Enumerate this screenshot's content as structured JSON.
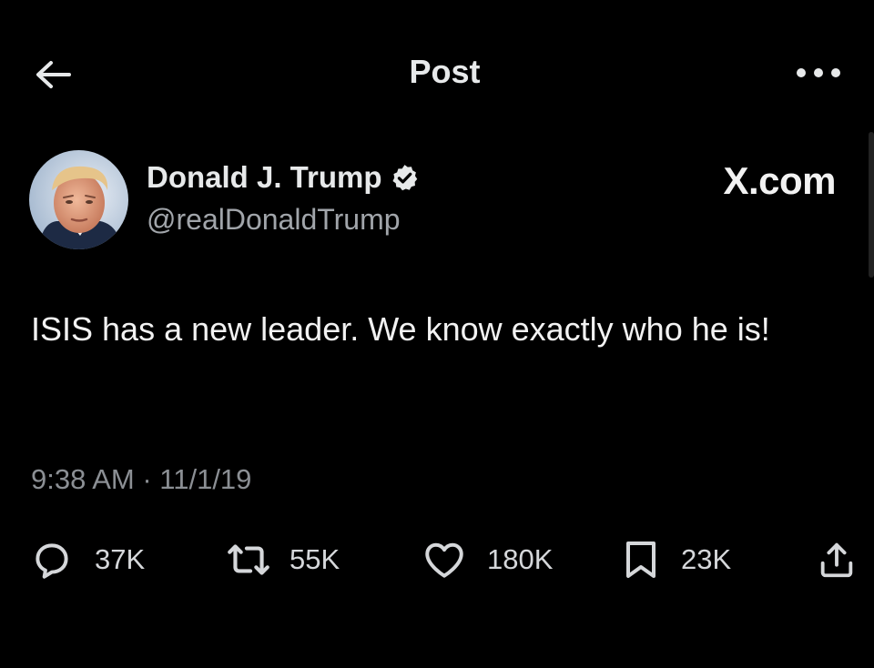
{
  "header": {
    "title": "Post",
    "back_icon": "arrow-left-icon",
    "more_icon": "more-horizontal-icon"
  },
  "post": {
    "author": {
      "display_name": "Donald J. Trump",
      "handle": "@realDonaldTrump",
      "verified_icon": "verified-badge-icon"
    },
    "watermark": "X.com",
    "text": "ISIS has a new leader. We know exactly who he is!",
    "timestamp": "9:38 AM · 11/1/19"
  },
  "actions": {
    "replies": "37K",
    "reposts": "55K",
    "likes": "180K",
    "bookmarks": "23K",
    "share_icon": "share-icon"
  },
  "colors": {
    "background": "#000000",
    "text_primary": "#e7e9ea",
    "text_secondary": "#8b8f94"
  }
}
